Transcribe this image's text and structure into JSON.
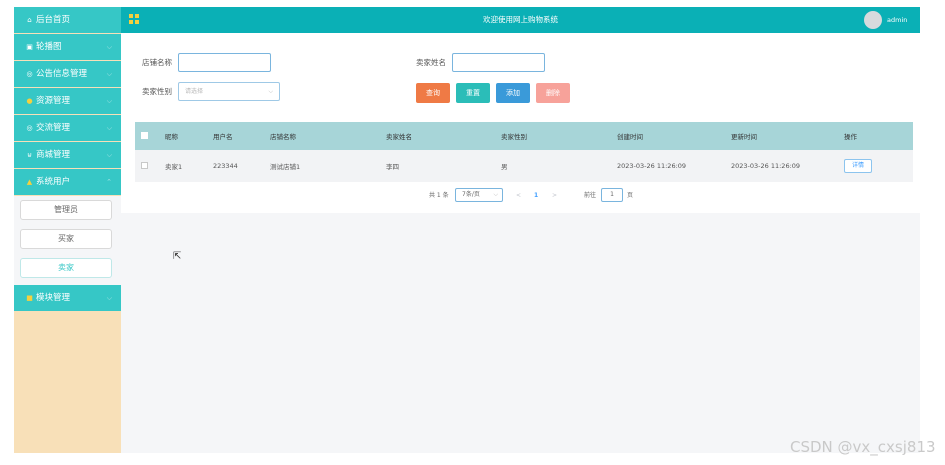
{
  "sidebar": {
    "items": [
      {
        "icon": "home-icon",
        "glyph": "⌂",
        "label": "后台首页",
        "expandable": false
      },
      {
        "icon": "image-icon",
        "glyph": "▣",
        "label": "轮播图",
        "expandable": true
      },
      {
        "icon": "notice-icon",
        "glyph": "◎",
        "label": "公告信息管理",
        "expandable": true
      },
      {
        "icon": "resource-icon",
        "glyph": "●",
        "label": "资源管理",
        "expandable": true
      },
      {
        "icon": "chat-icon",
        "glyph": "◎",
        "label": "交流管理",
        "expandable": true
      },
      {
        "icon": "cart-icon",
        "glyph": "⊌",
        "label": "商城管理",
        "expandable": true
      },
      {
        "icon": "user-icon",
        "glyph": "▲",
        "label": "系统用户",
        "expandable": true,
        "open": true
      },
      {
        "icon": "module-icon",
        "glyph": "■",
        "label": "模块管理",
        "expandable": true
      }
    ],
    "sub_items": [
      {
        "label": "管理员",
        "active": false
      },
      {
        "label": "买家",
        "active": false
      },
      {
        "label": "卖家",
        "active": true
      }
    ],
    "chevron": "⌵"
  },
  "header": {
    "title": "欢迎使用网上购物系统",
    "user": "admin"
  },
  "search": {
    "shop_name_label": "店铺名称",
    "seller_name_label": "卖家姓名",
    "seller_gender_label": "卖家性别",
    "gender_placeholder": "请选择"
  },
  "buttons": {
    "query": "查询",
    "reset": "重置",
    "add": "添加",
    "delete": "删除"
  },
  "colors": {
    "query": "#ef7a45",
    "reset": "#2bbdb8",
    "add": "#3a9ad9",
    "delete": "#f7a29a",
    "header": "#0ab0b6",
    "sidebar_item": "#36c7c6"
  },
  "table": {
    "headers": [
      "昵称",
      "用户名",
      "店铺名称",
      "卖家姓名",
      "卖家性别",
      "创建时间",
      "更新时间",
      "操作"
    ],
    "rows": [
      {
        "nickname": "卖家1",
        "username": "223344",
        "shop": "测试店铺1",
        "name": "李四",
        "gender": "男",
        "created": "2023-03-26 11:26:09",
        "updated": "2023-03-26 11:26:09",
        "action": "详情"
      }
    ]
  },
  "pagination": {
    "total": "共 1 条",
    "page_size": "7条/页",
    "prev": "<",
    "current": "1",
    "next": ">",
    "goto_label": "前往",
    "goto_value": "1",
    "page_unit": "页"
  },
  "watermark": "CSDN @vx_cxsj813"
}
